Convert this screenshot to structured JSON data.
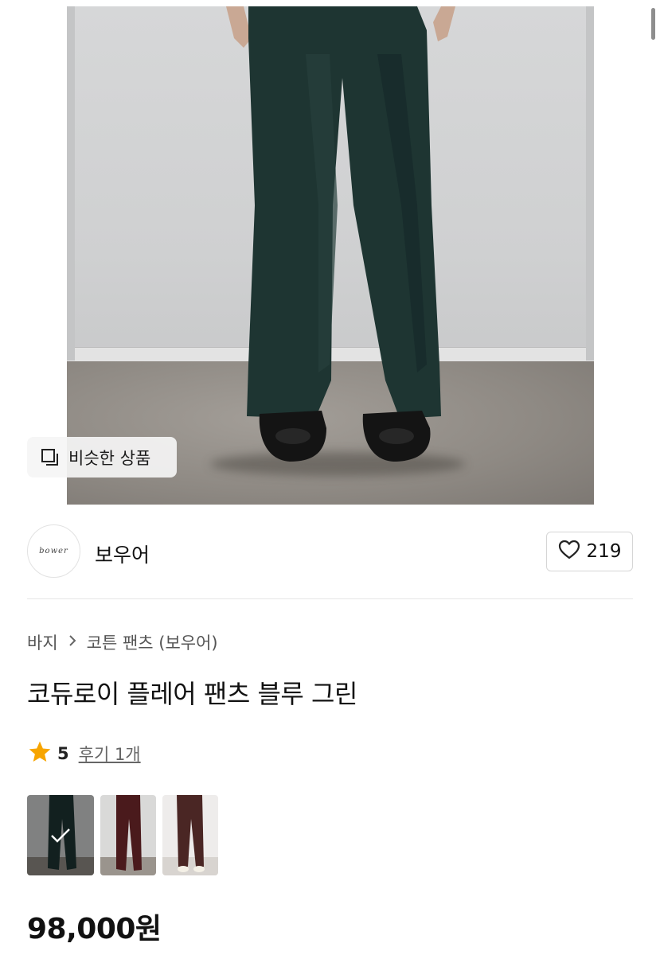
{
  "hero": {
    "similar_label": "비슷한 상품"
  },
  "shop": {
    "name": "보우어",
    "logo_text": "bower",
    "like_count": "219"
  },
  "product": {
    "breadcrumb": [
      "바지",
      "코튼 팬츠 (보우어)"
    ],
    "title": "코듀로이 플레어 팬츠 블루 그린",
    "rating": "5",
    "reviews": "후기 1개",
    "price": "98,000원",
    "variant_colors": [
      "blue-green",
      "burgundy",
      "brown"
    ],
    "selected_variant": 0
  },
  "colors": {
    "star": "#f7a500",
    "pants_green": "#1e3532"
  }
}
